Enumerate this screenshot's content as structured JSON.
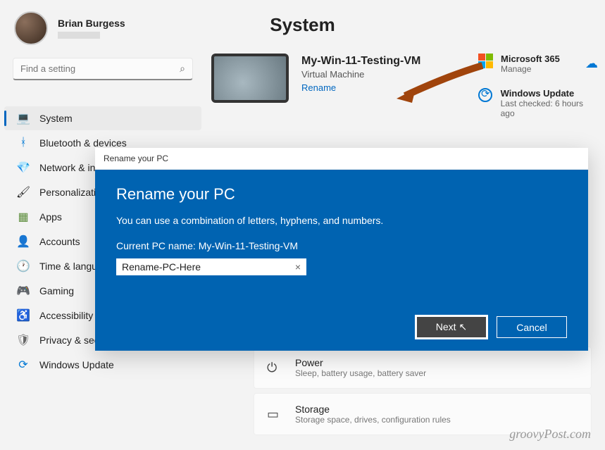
{
  "user": {
    "name": "Brian Burgess"
  },
  "page_title": "System",
  "search": {
    "placeholder": "Find a setting"
  },
  "sidebar": {
    "items": [
      {
        "label": "System",
        "icon": "💻"
      },
      {
        "label": "Bluetooth & devices",
        "icon": "ᚼ"
      },
      {
        "label": "Network & internet",
        "icon": "💎"
      },
      {
        "label": "Personalization",
        "icon": "🖌"
      },
      {
        "label": "Apps",
        "icon": "▦"
      },
      {
        "label": "Accounts",
        "icon": "👤"
      },
      {
        "label": "Time & language",
        "icon": "🕐"
      },
      {
        "label": "Gaming",
        "icon": "🎮"
      },
      {
        "label": "Accessibility",
        "icon": "♿"
      },
      {
        "label": "Privacy & security",
        "icon": "🛡"
      },
      {
        "label": "Windows Update",
        "icon": "⟳"
      }
    ]
  },
  "pc": {
    "name": "My-Win-11-Testing-VM",
    "type": "Virtual Machine",
    "rename": "Rename"
  },
  "right": {
    "ms365": {
      "title": "Microsoft 365",
      "sub": "Manage"
    },
    "update": {
      "title": "Windows Update",
      "sub": "Last checked: 6 hours ago"
    }
  },
  "dialog": {
    "titlebar": "Rename your PC",
    "heading": "Rename your PC",
    "desc": "You can use a combination of letters, hyphens, and numbers.",
    "current_label": "Current PC name: My-Win-11-Testing-VM",
    "input_value": "Rename-PC-Here",
    "next": "Next",
    "cancel": "Cancel"
  },
  "settings_rows": [
    {
      "title": "Power",
      "desc": "Sleep, battery usage, battery saver",
      "icon": "⏻"
    },
    {
      "title": "Storage",
      "desc": "Storage space, drives, configuration rules",
      "icon": "▭"
    }
  ],
  "watermark": "groovyPost.com"
}
